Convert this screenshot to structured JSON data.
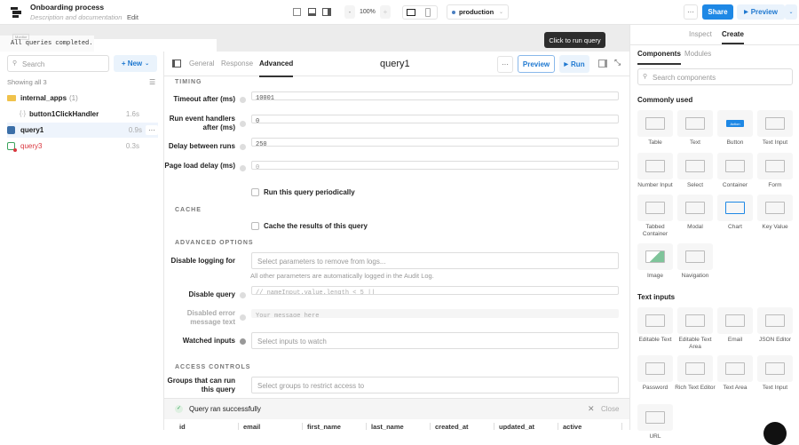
{
  "app": {
    "title": "Onboarding process",
    "subtitle": "Description and documentation",
    "edit": "Edit",
    "zoom": "100%",
    "zoom_minus": "-",
    "zoom_plus": "+",
    "environment": "production",
    "more": "···",
    "share": "Share",
    "preview": "Preview"
  },
  "status": {
    "monitor": "Monitor",
    "message": "All queries completed."
  },
  "tooltip": "Click to run query",
  "left": {
    "search_placeholder": "Search",
    "new": "+ New",
    "showing": "Showing all 3",
    "items": [
      {
        "name": "internal_apps",
        "count": "(1)"
      },
      {
        "name": "button1ClickHandler",
        "time": "1.6s"
      },
      {
        "name": "query1",
        "time": "0.9s"
      },
      {
        "name": "query3",
        "time": "0.3s"
      }
    ]
  },
  "editor": {
    "tabs": [
      "General",
      "Response",
      "Advanced"
    ],
    "title": "query1",
    "more": "···",
    "preview": "Preview",
    "run": "Run",
    "timing": "TIMING",
    "timeout_label": "Timeout after (ms)",
    "timeout_value": "10001",
    "run_handlers_label": "Run event handlers after (ms)",
    "run_handlers_value": "0",
    "delay_label": "Delay between runs",
    "delay_value": "250",
    "page_load_label": "Page load delay (ms)",
    "page_load_value": "0",
    "periodic": "Run this query periodically",
    "cache": "CACHE",
    "cache_results": "Cache the results of this query",
    "advanced": "ADVANCED OPTIONS",
    "disable_logging_label": "Disable logging for",
    "disable_logging_placeholder": "Select parameters to remove from logs...",
    "logging_hint": "All other parameters are automatically logged in the Audit Log.",
    "disable_query_label": "Disable query",
    "disable_query_placeholder": "// nameInput.value.length < 5 ||",
    "error_text_label": "Disabled error message text",
    "error_text_placeholder": "Your message here",
    "watched_label": "Watched inputs",
    "watched_placeholder": "Select inputs to watch",
    "access": "ACCESS CONTROLS",
    "groups_label": "Groups that can run this query",
    "groups_placeholder": "Select groups to restrict access to",
    "result": "Query ran successfully",
    "close": "Close",
    "columns": [
      "id",
      "email",
      "first_name",
      "last_name",
      "created_at",
      "updated_at",
      "active"
    ]
  },
  "right": {
    "tabs": [
      "Inspect",
      "Create"
    ],
    "subtabs": [
      "Components",
      "Modules"
    ],
    "search_placeholder": "Search components",
    "common": "Commonly used",
    "common_items": [
      "Table",
      "Text",
      "Button",
      "Text Input",
      "Number Input",
      "Select",
      "Container",
      "Form",
      "Tabbed Container",
      "Modal",
      "Chart",
      "Key Value",
      "Image",
      "Navigation"
    ],
    "text_inputs": "Text inputs",
    "text_items": [
      "Editable Text",
      "Editable Text Area",
      "Email",
      "JSON Editor",
      "Password",
      "Rich Text Editor",
      "Text Area",
      "Text Input",
      "URL"
    ],
    "button_glyph": "Action"
  },
  "colors": {
    "accent": "#1e88e5",
    "error": "#d9363e"
  }
}
